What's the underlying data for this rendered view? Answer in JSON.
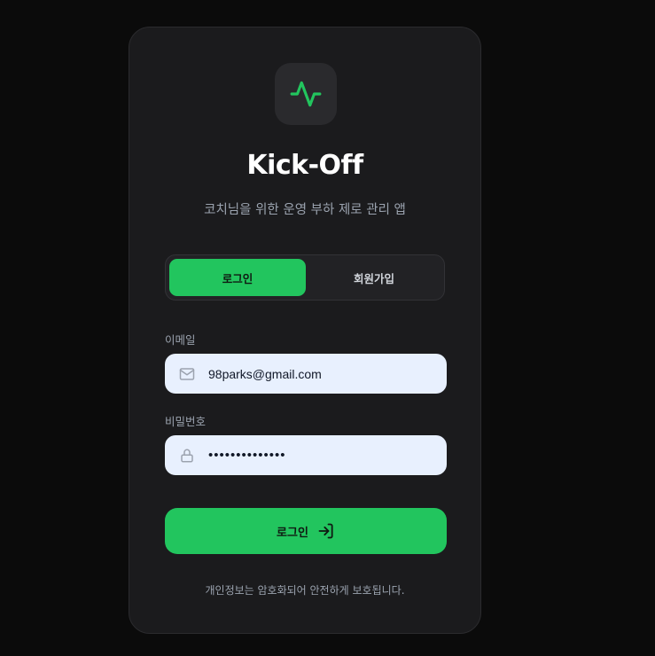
{
  "app": {
    "title": "Kick-Off",
    "subtitle": "코치님을 위한 운영 부하 제로 관리 앱"
  },
  "tabs": [
    {
      "label": "로그인",
      "active": true
    },
    {
      "label": "회원가입",
      "active": false
    }
  ],
  "form": {
    "email_label": "이메일",
    "email_value": "98parks@gmail.com",
    "password_label": "비밀번호",
    "password_value": "••••••••••••••",
    "submit_label": "로그인"
  },
  "footer": {
    "notice": "개인정보는 암호화되어 안전하게 보호됩니다."
  },
  "icons": {
    "logo": "activity-pulse-icon",
    "email": "mail-icon",
    "password": "lock-icon",
    "submit": "log-in-arrow-icon"
  },
  "colors": {
    "accent": "#22c55e",
    "background": "#0b0b0b",
    "card": "#1b1b1d",
    "input_bg": "#e8f0fe"
  }
}
